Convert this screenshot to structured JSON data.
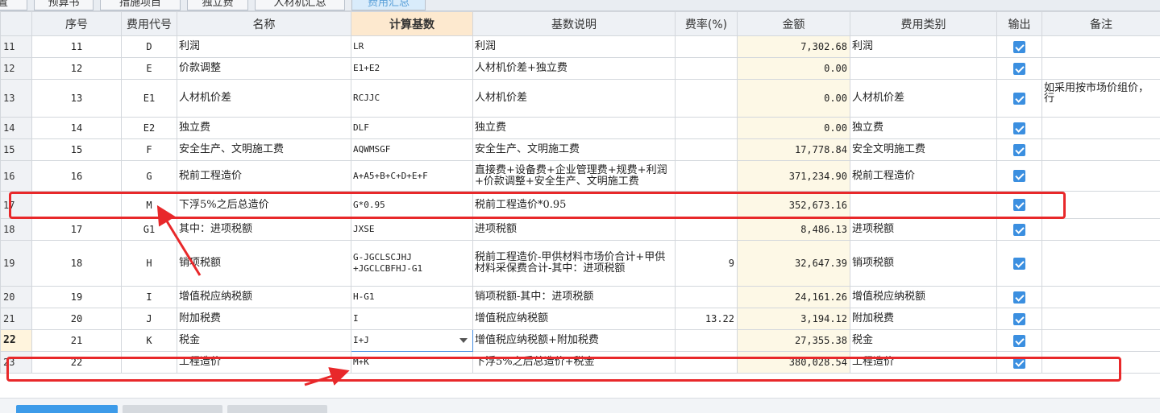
{
  "tabs": [
    {
      "label": "设置"
    },
    {
      "label": "预算书"
    },
    {
      "label": "措施项目"
    },
    {
      "label": "独立费"
    },
    {
      "label": "人材机汇总"
    },
    {
      "label": "费用汇总",
      "active": true
    }
  ],
  "columns": [
    "序号",
    "费用代号",
    "名称",
    "计算基数",
    "基数说明",
    "费率(%)",
    "金额",
    "费用类别",
    "输出",
    "备注"
  ],
  "rows": [
    {
      "rownum": "11",
      "seq": "11",
      "code": "D",
      "name": "利润",
      "basis": "LR",
      "basis_desc": "利润",
      "rate": "",
      "amount": "7,302.68",
      "category": "利润",
      "output": true,
      "note": ""
    },
    {
      "rownum": "12",
      "seq": "12",
      "code": "E",
      "name": "价款调整",
      "basis": "E1+E2",
      "basis_desc": "人材机价差+独立费",
      "rate": "",
      "amount": "0.00",
      "category": "",
      "output": true,
      "note": ""
    },
    {
      "rownum": "13",
      "seq": "13",
      "code": "E1",
      "name": "人材机价差",
      "basis": "RCJJC",
      "basis_desc": "人材机价差",
      "rate": "",
      "amount": "0.00",
      "category": "人材机价差",
      "output": true,
      "note": "如采用按市场价组价，行"
    },
    {
      "rownum": "14",
      "seq": "14",
      "code": "E2",
      "name": "独立费",
      "basis": "DLF",
      "basis_desc": "独立费",
      "rate": "",
      "amount": "0.00",
      "category": "独立费",
      "output": true,
      "note": ""
    },
    {
      "rownum": "15",
      "seq": "15",
      "code": "F",
      "name": "安全生产、文明施工费",
      "basis": "AQWMSGF",
      "basis_desc": "安全生产、文明施工费",
      "rate": "",
      "amount": "17,778.84",
      "category": "安全文明施工费",
      "output": true,
      "note": ""
    },
    {
      "rownum": "16",
      "seq": "16",
      "code": "G",
      "name": "税前工程造价",
      "basis": "A+A5+B+C+D+E+F",
      "basis_desc": "直接费+设备费+企业管理费+规费+利润+价款调整+安全生产、文明施工费",
      "rate": "",
      "amount": "371,234.90",
      "category": "税前工程造价",
      "output": true,
      "note": ""
    },
    {
      "rownum": "17",
      "seq": "",
      "code": "M",
      "name": "下浮5%之后总造价",
      "basis": "G*0.95",
      "basis_desc": "税前工程造价*0.95",
      "rate": "",
      "amount": "352,673.16",
      "category": "",
      "output": true,
      "note": ""
    },
    {
      "rownum": "18",
      "seq": "17",
      "code": "G1",
      "name": "其中：进项税额",
      "basis": "JXSE",
      "basis_desc": "进项税额",
      "rate": "",
      "amount": "8,486.13",
      "category": "进项税额",
      "output": true,
      "note": ""
    },
    {
      "rownum": "19",
      "seq": "18",
      "code": "H",
      "name": "销项税额",
      "basis": "G-JGCLSCJHJ +JGCLCBFHJ-G1",
      "basis_desc": "税前工程造价-甲供材料市场价合计+甲供材料采保费合计-其中：进项税额",
      "rate": "9",
      "amount": "32,647.39",
      "category": "销项税额",
      "output": true,
      "note": ""
    },
    {
      "rownum": "20",
      "seq": "19",
      "code": "I",
      "name": "增值税应纳税额",
      "basis": "H-G1",
      "basis_desc": "销项税额-其中：进项税额",
      "rate": "",
      "amount": "24,161.26",
      "category": "增值税应纳税额",
      "output": true,
      "note": ""
    },
    {
      "rownum": "21",
      "seq": "20",
      "code": "J",
      "name": "附加税费",
      "basis": "I",
      "basis_desc": "增值税应纳税额",
      "rate": "13.22",
      "amount": "3,194.12",
      "category": "附加税费",
      "output": true,
      "note": ""
    },
    {
      "rownum": "22",
      "seq": "21",
      "code": "K",
      "name": "税金",
      "basis": "I+J",
      "basis_desc": "增值税应纳税额+附加税费",
      "rate": "",
      "amount": "27,355.38",
      "category": "税金",
      "output": true,
      "note": ""
    },
    {
      "rownum": "23",
      "seq": "22",
      "code": "",
      "name": "工程造价",
      "basis": "M+K",
      "basis_desc": "下浮5%之后总造价+税金",
      "rate": "",
      "amount": "380,028.54",
      "category": "工程造价",
      "output": true,
      "note": ""
    }
  ],
  "current_row": "22",
  "colors": {
    "highlight": "#e8282a",
    "checkbox": "#3b8fe0",
    "header_active": "#fde9cf",
    "amount_bg": "#fdf8e6"
  },
  "annotations": [
    "highlight-row-17",
    "highlight-row-23",
    "arrow-to-code-M",
    "arrow-to-basis-M+K"
  ]
}
